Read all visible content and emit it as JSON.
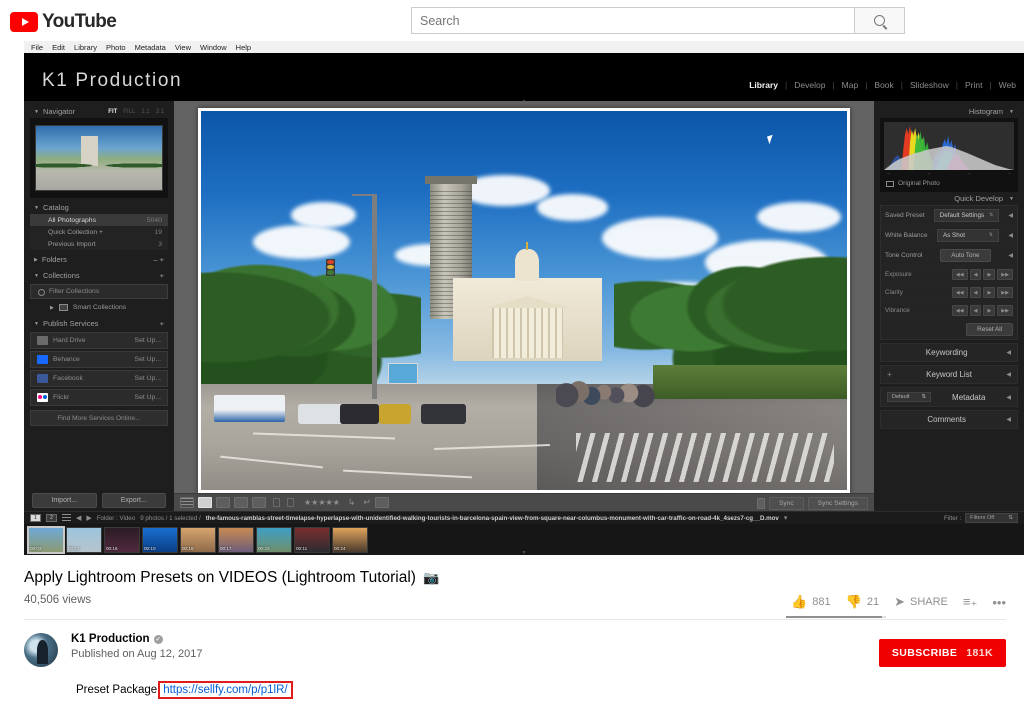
{
  "youtube_header": {
    "logo_text": "YouTube",
    "search_placeholder": "Search",
    "search_value": ""
  },
  "lightroom": {
    "menu": [
      "File",
      "Edit",
      "Library",
      "Photo",
      "Metadata",
      "View",
      "Window",
      "Help"
    ],
    "brand": "K1 Production",
    "modules": [
      {
        "label": "Library",
        "active": true
      },
      {
        "label": "Develop",
        "active": false
      },
      {
        "label": "Map",
        "active": false
      },
      {
        "label": "Book",
        "active": false
      },
      {
        "label": "Slideshow",
        "active": false
      },
      {
        "label": "Print",
        "active": false
      },
      {
        "label": "Web",
        "active": false
      }
    ],
    "left_panel": {
      "navigator": {
        "title": "Navigator",
        "zoom_levels": [
          {
            "label": "FIT",
            "active": true
          },
          {
            "label": "FILL",
            "active": false
          },
          {
            "label": "1:1",
            "active": false
          },
          {
            "label": "3:1",
            "active": false
          }
        ]
      },
      "catalog": {
        "title": "Catalog",
        "rows": [
          {
            "label": "All Photographs",
            "count": "5040",
            "selected": true
          },
          {
            "label": "Quick Collection  +",
            "count": "19",
            "selected": false
          },
          {
            "label": "Previous Import",
            "count": "3",
            "selected": false
          }
        ]
      },
      "folders": {
        "title": "Folders"
      },
      "collections": {
        "title": "Collections",
        "filter_label": "Filter Collections",
        "smart_label": "Smart Collections"
      },
      "publish_services": {
        "title": "Publish Services",
        "services": [
          {
            "name": "Hard Drive",
            "action": "Set Up...",
            "icon": "harddrive-icon"
          },
          {
            "name": "Behance",
            "action": "Set Up...",
            "icon": "behance-icon"
          },
          {
            "name": "Facebook",
            "action": "Set Up...",
            "icon": "facebook-icon"
          },
          {
            "name": "Flickr",
            "action": "Set Up...",
            "icon": "flickr-icon"
          }
        ],
        "find_more": "Find More Services Online..."
      },
      "buttons": {
        "import": "Import...",
        "export": "Export..."
      }
    },
    "right_panel": {
      "histogram": {
        "title": "Histogram",
        "original_photo": "Original Photo",
        "ticks": [
          "–",
          "–",
          "–",
          "–"
        ]
      },
      "quick_develop": {
        "title": "Quick Develop",
        "rows": [
          {
            "label": "Saved Preset",
            "value": "Default Settings"
          },
          {
            "label": "White Balance",
            "value": "As Shot"
          }
        ],
        "tone_control_label": "Tone Control",
        "auto_tone": "Auto Tone",
        "exposure_label": "Exposure",
        "clarity_label": "Clarity",
        "vibrance_label": "Vibrance",
        "reset_all": "Reset All"
      },
      "panels": [
        {
          "label": "Keywording"
        },
        {
          "label": "Keyword List"
        },
        {
          "label": "Metadata",
          "select": "Default"
        },
        {
          "label": "Comments"
        }
      ]
    },
    "toolbar": {
      "sync": "Sync",
      "sync_settings": "Sync Settings"
    },
    "filmstrip": {
      "page_numbers": [
        "1",
        "2"
      ],
      "folder_label": "Folder : Video",
      "count_label": "9 photos / 1 selected /",
      "filename": "the-famous-ramblas-street-timelapse-hyperlapse-with-unidentified-walking-tourists-in-barcelona-spain-view-from-square-near-columbus-monument-with-car-traffic-on-road-4k_4sezs7-cg__D.mov",
      "filter_label": "Filter :",
      "filter_value": "Filters Off",
      "thumbnails": [
        {
          "duration": "00:03",
          "selected": true,
          "c1": "#6ea8d6",
          "c2": "#8c9a72"
        },
        {
          "duration": "00:14",
          "selected": false,
          "c1": "#9cc4dd",
          "c2": "#b7c4cc"
        },
        {
          "duration": "00:16",
          "selected": false,
          "c1": "#2a1c24",
          "c2": "#512a3e"
        },
        {
          "duration": "00:10",
          "selected": false,
          "c1": "#1a6fd0",
          "c2": "#0b3f86"
        },
        {
          "duration": "00:18",
          "selected": false,
          "c1": "#d6a46e",
          "c2": "#8f6a4a"
        },
        {
          "duration": "00:17",
          "selected": false,
          "c1": "#c98a52",
          "c2": "#6d5d7a"
        },
        {
          "duration": "00:22",
          "selected": false,
          "c1": "#3f9fc4",
          "c2": "#6f8f6a"
        },
        {
          "duration": "00:11",
          "selected": false,
          "c1": "#7a2e2e",
          "c2": "#2c2c30"
        },
        {
          "duration": "00:24",
          "selected": false,
          "c1": "#e0a35c",
          "c2": "#4a3b2e"
        }
      ]
    }
  },
  "video": {
    "title": "Apply Lightroom Presets on VIDEOS (Lightroom Tutorial)",
    "title_emoji": "📷",
    "views": "40,506 views",
    "likes": "881",
    "dislikes": "21",
    "share_label": "SHARE",
    "channel_name": "K1 Production",
    "published": "Published on Aug 12, 2017",
    "subscribe_label": "SUBSCRIBE",
    "subscriber_count": "181K",
    "description_prefix": "Preset Package",
    "description_link": "https://sellfy.com/p/p1lR/"
  },
  "colors": {
    "youtube_red": "#ff0000",
    "subscribe_red": "#f00000",
    "link_blue": "#065fd4",
    "highlight_red": "#e01b1b"
  }
}
